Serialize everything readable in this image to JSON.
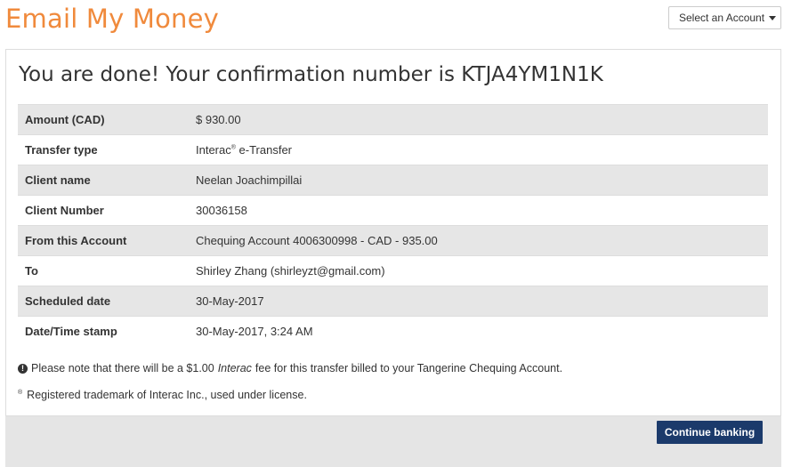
{
  "header": {
    "title": "Email My Money",
    "account_select": {
      "label": "Select an Account"
    }
  },
  "confirmation": {
    "heading": "You are done! Your confirmation number is KTJA4YM1N1K"
  },
  "details": [
    {
      "label": "Amount (CAD)",
      "value": "$ 930.00"
    },
    {
      "label": "Transfer type",
      "value": "Interac",
      "value_mark": "®",
      "value_suffix": " e-Transfer"
    },
    {
      "label": "Client name",
      "value": "Neelan Joachimpillai"
    },
    {
      "label": "Client Number",
      "value": "30036158"
    },
    {
      "label": "From this Account",
      "value": "Chequing Account 4006300998 - CAD - 935.00"
    },
    {
      "label": "To",
      "value": "Shirley Zhang (shirleyzt@gmail.com)"
    },
    {
      "label": "Scheduled date",
      "value": "30-May-2017"
    },
    {
      "label": "Date/Time stamp",
      "value": "30-May-2017, 3:24 AM"
    }
  ],
  "note": {
    "icon": "info-icon",
    "icon_glyph": "!",
    "prefix": "Please note that there will be a $1.00",
    "emphasis": "Interac",
    "suffix": "fee for this transfer billed to your Tangerine Chequing Account."
  },
  "trademark": {
    "mark": "®",
    "text": "Registered trademark of Interac Inc., used under license."
  },
  "footer": {
    "continue_label": "Continue banking"
  },
  "colors": {
    "brand_orange": "#f08a3c",
    "button_navy": "#1b3a6b",
    "row_stripe": "#e6e6e6"
  }
}
